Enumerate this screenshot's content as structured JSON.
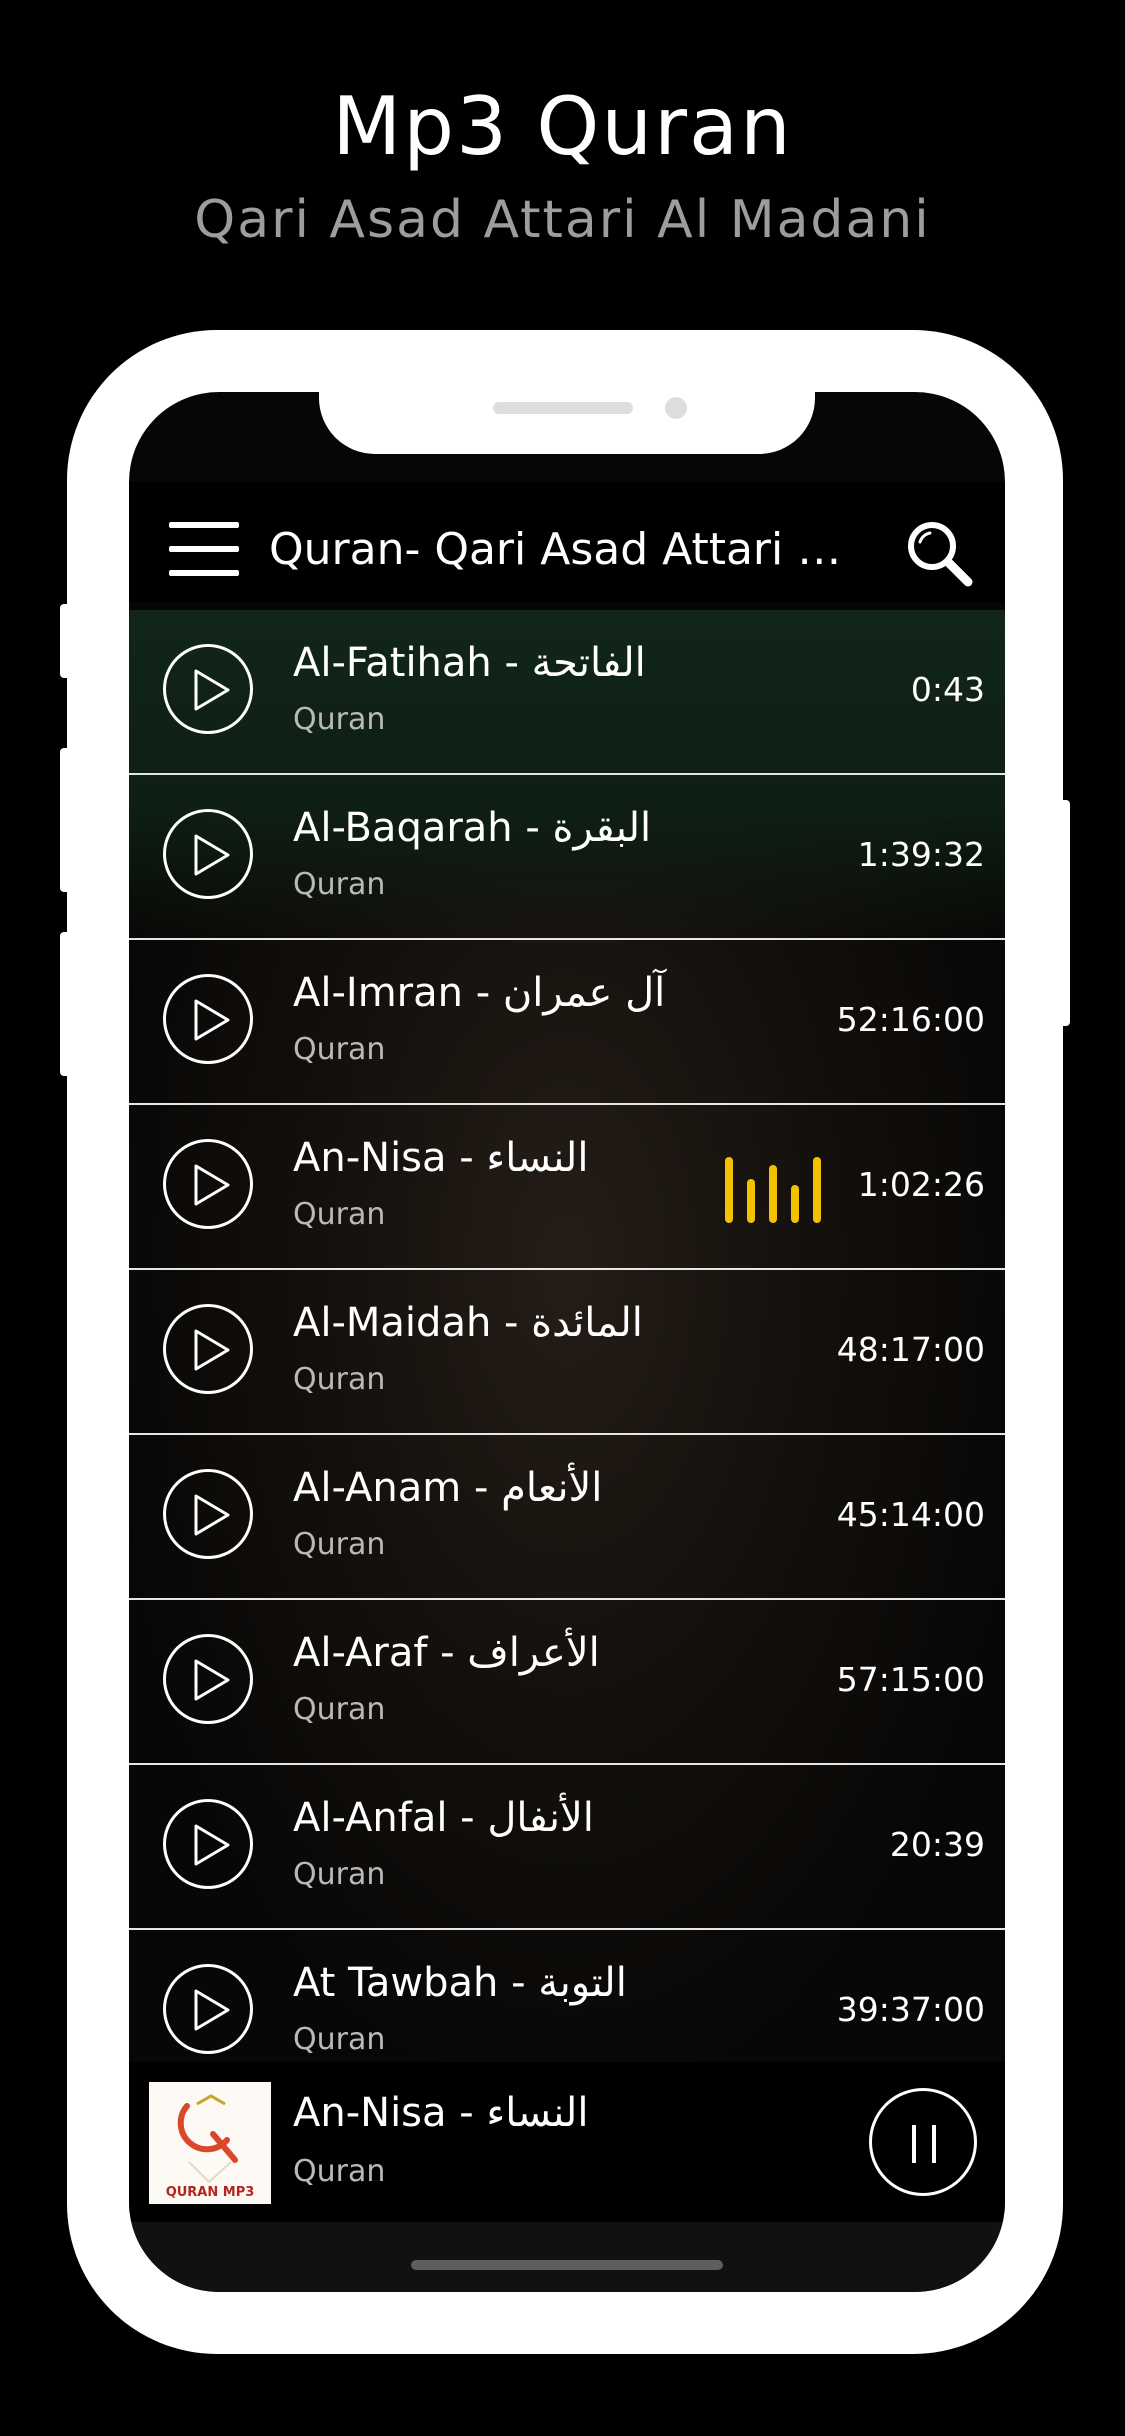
{
  "promo": {
    "title": "Mp3 Quran",
    "subtitle": "Qari Asad Attari Al Madani"
  },
  "app_bar": {
    "title": "Quran- Qari Asad Attari Al...",
    "menu_icon": "hamburger-menu-icon",
    "search_icon": "search-icon"
  },
  "tracks": [
    {
      "title": "Al-Fatihah - الفاتحة",
      "subtitle": "Quran",
      "duration": "0:43",
      "playing": false
    },
    {
      "title": "Al-Baqarah - البقرة",
      "subtitle": "Quran",
      "duration": "1:39:32",
      "playing": false
    },
    {
      "title": "Al-Imran - آل عمران",
      "subtitle": "Quran",
      "duration": "52:16:00",
      "playing": false
    },
    {
      "title": "An-Nisa - النساء",
      "subtitle": "Quran",
      "duration": "1:02:26",
      "playing": true
    },
    {
      "title": "Al-Maidah - المائدة",
      "subtitle": "Quran",
      "duration": "48:17:00",
      "playing": false
    },
    {
      "title": "Al-Anam - الأنعام",
      "subtitle": "Quran",
      "duration": "45:14:00",
      "playing": false
    },
    {
      "title": "Al-Araf - الأعراف",
      "subtitle": "Quran",
      "duration": "57:15:00",
      "playing": false
    },
    {
      "title": "Al-Anfal - الأنفال",
      "subtitle": "Quran",
      "duration": "20:39",
      "playing": false
    },
    {
      "title": "At Tawbah - التوبة",
      "subtitle": "Quran",
      "duration": "39:37:00",
      "playing": false
    }
  ],
  "now_playing": {
    "title": "An-Nisa - النساء",
    "subtitle": "Quran",
    "art_label": "QURAN MP3",
    "control_icon": "pause-icon"
  },
  "colors": {
    "accent": "#f2c200",
    "background": "#000000",
    "divider": "#e6e6e6",
    "subtext": "#b9b9b9"
  }
}
